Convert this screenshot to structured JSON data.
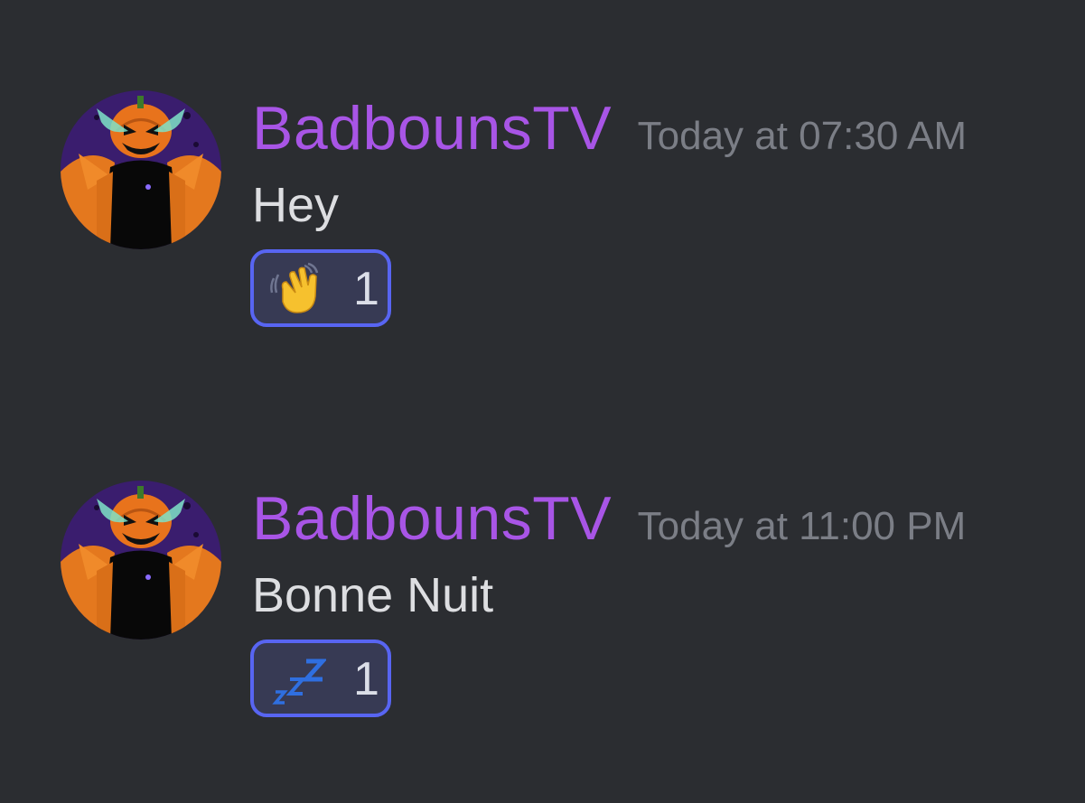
{
  "theme": {
    "background": "#2b2d31",
    "username_color": "#a855e6",
    "timestamp_color": "#7b7e86",
    "text_color": "#dddee1",
    "reaction_border": "#5865f2",
    "reaction_background": "#373a54"
  },
  "messages": [
    {
      "author": "BadbounsTV",
      "timestamp": "Today at 07:30 AM",
      "text": "Hey",
      "avatar_icon": "pumpkin-head-avatar",
      "reaction": {
        "emoji_icon": "waving-hand-icon",
        "count": "1",
        "reacted": true
      }
    },
    {
      "author": "BadbounsTV",
      "timestamp": "Today at 11:00 PM",
      "text": "Bonne Nuit",
      "avatar_icon": "pumpkin-head-avatar",
      "reaction": {
        "emoji_icon": "zzz-sleeping-icon",
        "count": "1",
        "reacted": true
      }
    }
  ]
}
